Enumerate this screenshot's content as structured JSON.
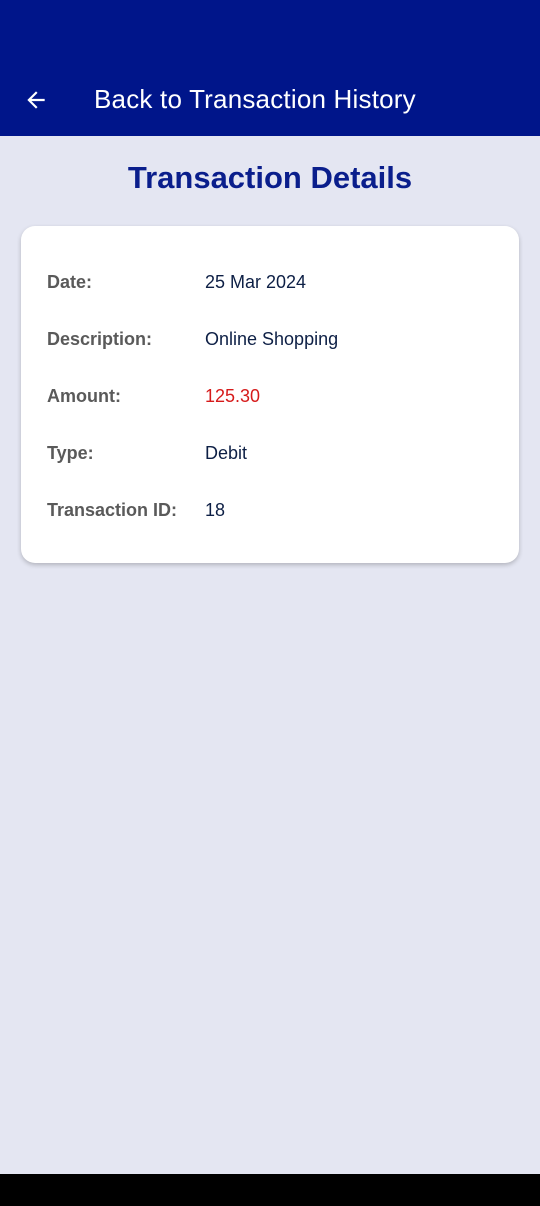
{
  "app_bar": {
    "back_label": "Back to Transaction History",
    "back_icon": "arrow-left-icon",
    "background": "#00158a"
  },
  "page": {
    "title": "Transaction Details"
  },
  "details": {
    "date": {
      "label": "Date:",
      "value": "25 Mar 2024"
    },
    "description": {
      "label": "Description:",
      "value": "Online Shopping"
    },
    "amount": {
      "label": "Amount:",
      "value": "125.30",
      "color": "#d61a1a"
    },
    "type": {
      "label": "Type:",
      "value": "Debit"
    },
    "transaction_id": {
      "label": "Transaction ID:",
      "value": "18"
    }
  }
}
